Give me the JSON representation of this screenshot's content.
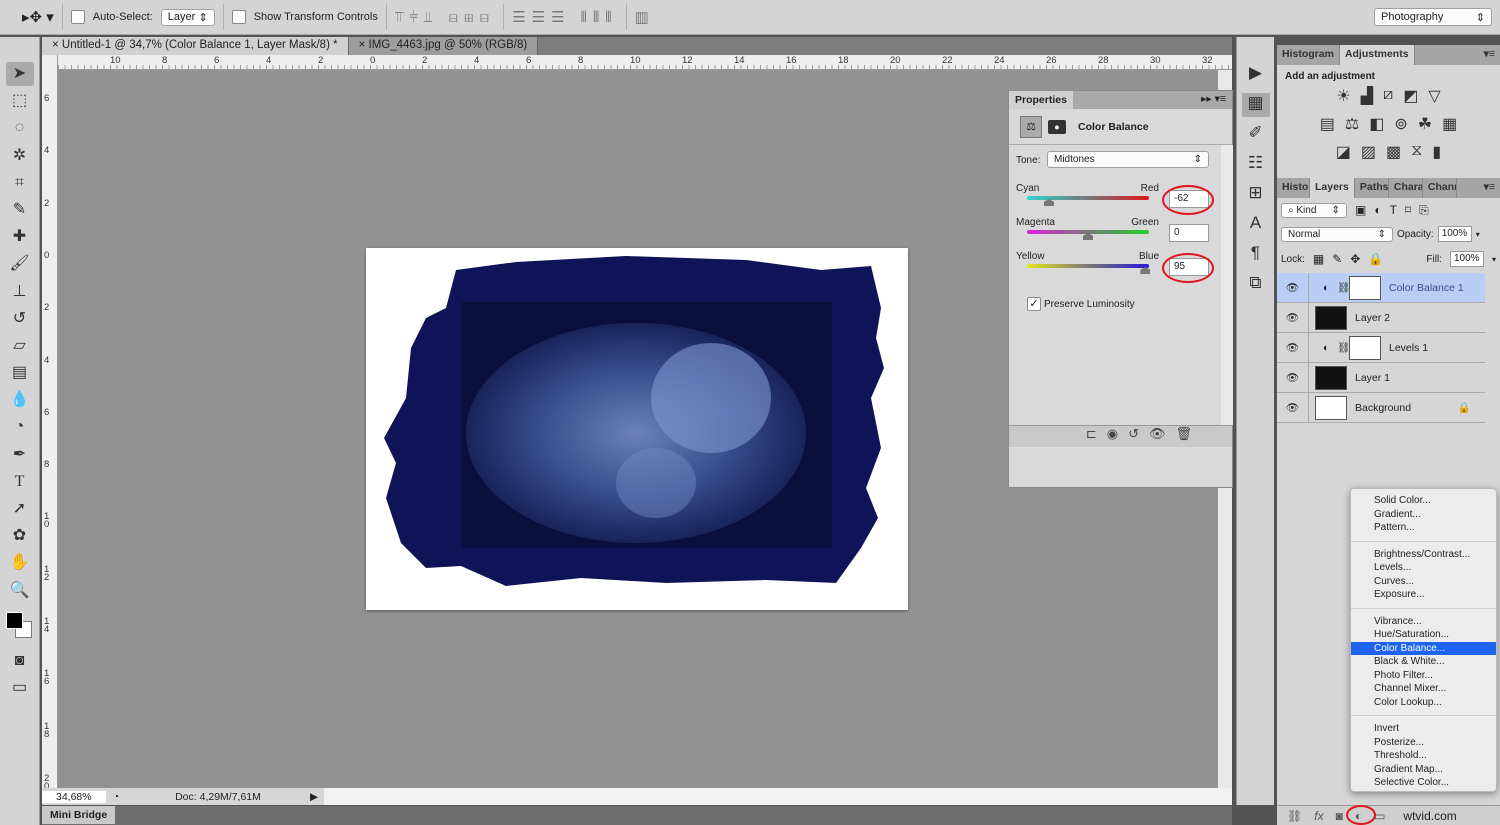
{
  "options_bar": {
    "auto_select_label": "Auto-Select:",
    "auto_select_target": "Layer",
    "show_transform_label": "Show Transform Controls",
    "workspace": "Photography"
  },
  "tabs": [
    {
      "label": "Untitled-1 @ 34,7% (Color Balance 1, Layer Mask/8) *",
      "active": true
    },
    {
      "label": "IMG_4463.jpg @ 50% (RGB/8)",
      "active": false
    }
  ],
  "ruler": {
    "horizontal": [
      "10",
      "8",
      "6",
      "4",
      "2",
      "0",
      "2",
      "4",
      "6",
      "8",
      "10",
      "12",
      "14",
      "16",
      "18",
      "20",
      "22",
      "24",
      "26",
      "28",
      "30",
      "32"
    ],
    "vertical": [
      "6",
      "4",
      "2",
      "0",
      "2",
      "4",
      "6",
      "8",
      "10",
      "12",
      "14",
      "16",
      "18",
      "20"
    ]
  },
  "status": {
    "zoom": "34,68%",
    "doc": "Doc: 4,29M/7,61M"
  },
  "mini_bridge": "Mini Bridge",
  "properties": {
    "title": "Properties",
    "adjustment": "Color Balance",
    "tone_label": "Tone:",
    "tone": "Midtones",
    "sliders": [
      {
        "left": "Cyan",
        "right": "Red",
        "value": "-62",
        "fraction": 0.18
      },
      {
        "left": "Magenta",
        "right": "Green",
        "value": "0",
        "fraction": 0.5
      },
      {
        "left": "Yellow",
        "right": "Blue",
        "value": "95",
        "fraction": 0.97
      }
    ],
    "preserve_luminosity": "Preserve Luminosity"
  },
  "adjustments": {
    "tabs": [
      "Histogram",
      "Adjustments"
    ],
    "heading": "Add an adjustment"
  },
  "layers": {
    "tabs": [
      "Histo",
      "Layers",
      "Paths",
      "Chara",
      "Chanr"
    ],
    "filter": "Kind",
    "blend": "Normal",
    "opacity_label": "Opacity:",
    "opacity": "100%",
    "lock_label": "Lock:",
    "fill_label": "Fill:",
    "fill": "100%",
    "items": [
      {
        "name": "Color Balance 1",
        "selected": true
      },
      {
        "name": "Layer 2"
      },
      {
        "name": "Levels 1"
      },
      {
        "name": "Layer 1"
      },
      {
        "name": "Background"
      }
    ]
  },
  "menu": {
    "groups": [
      [
        "Solid Color...",
        "Gradient...",
        "Pattern..."
      ],
      [
        "Brightness/Contrast...",
        "Levels...",
        "Curves...",
        "Exposure..."
      ],
      [
        "Vibrance...",
        "Hue/Saturation...",
        "Color Balance...",
        "Black & White...",
        "Photo Filter...",
        "Channel Mixer...",
        "Color Lookup..."
      ],
      [
        "Invert",
        "Posterize...",
        "Threshold...",
        "Gradient Map...",
        "Selective Color..."
      ]
    ],
    "highlighted": "Color Balance..."
  },
  "watermark": "wtvid.com",
  "colors": {
    "frame": "#0e1457",
    "highlight": "#1d63f0",
    "annotation": "#e0161b"
  }
}
